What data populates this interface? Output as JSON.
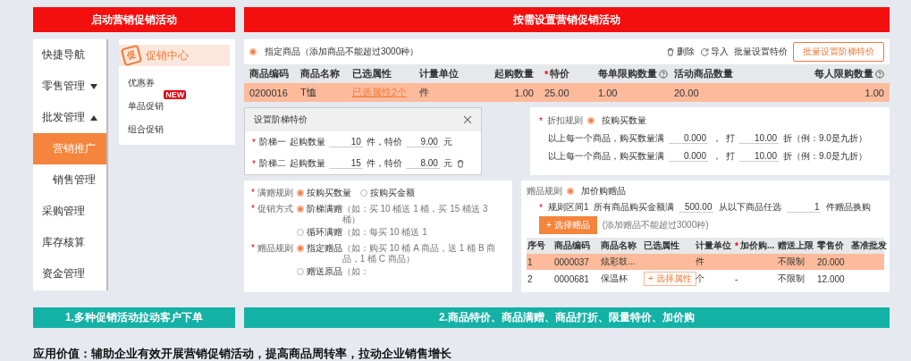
{
  "left": {
    "banner": "启动营销促销活动",
    "sidebar": {
      "items": [
        {
          "label": "快捷导航",
          "selected": false
        },
        {
          "label": "零售管理",
          "selected": false,
          "expanded": false
        },
        {
          "label": "批发管理",
          "selected": false,
          "expanded": true,
          "children": [
            {
              "label": "营销推广",
              "selected": true
            },
            {
              "label": "销售管理",
              "selected": false
            }
          ]
        },
        {
          "label": "采购管理",
          "selected": false
        },
        {
          "label": "库存核算",
          "selected": false
        },
        {
          "label": "资金管理",
          "selected": false
        }
      ]
    },
    "submenu": {
      "logo": "促",
      "title": "促销中心",
      "items": [
        {
          "label": "优惠券"
        },
        {
          "label": "单品促销",
          "badge": "NEW"
        },
        {
          "label": "组合促销"
        }
      ]
    },
    "caption": "1.多种促销活动拉动客户下单"
  },
  "right": {
    "banner": "按需设置营销促销活动",
    "product_table": {
      "scope": {
        "label": "指定商品（添加商品不能超过3000种）",
        "selected": true
      },
      "actions": [
        {
          "kind": "delete",
          "label": "删除"
        },
        {
          "kind": "import",
          "label": "导入"
        },
        {
          "kind": "link",
          "label": "批量设置特价"
        },
        {
          "kind": "button",
          "label": "批量设置阶梯特价"
        }
      ],
      "columns": [
        {
          "label": "商品编码"
        },
        {
          "label": "商品名称"
        },
        {
          "label": "已选属性",
          "kind": "link"
        },
        {
          "label": "计量单位"
        },
        {
          "label": "起购数量",
          "numeric": true
        },
        {
          "label": "特价",
          "mark": "*"
        },
        {
          "label": "每单限购数量",
          "help": true
        },
        {
          "label": "活动商品数量"
        },
        {
          "label": "每人限购数量",
          "help": true,
          "numeric": true
        }
      ],
      "rows": [
        {
          "selected": true,
          "cells": [
            "0200016",
            "T恤",
            "已选属性2个",
            "件",
            "1.00",
            "25.00",
            "1.00",
            "20.00",
            "1.00"
          ]
        }
      ]
    },
    "tier_dialog": {
      "title": "设置阶梯特价",
      "tiers": [
        {
          "mark": "*",
          "label": "阶梯一",
          "qty_label": "起购数量",
          "qty": "10",
          "unit": "件，特价",
          "price": "9.00",
          "currency": "元",
          "deletable": false
        },
        {
          "mark": "*",
          "label": "阶梯二",
          "qty_label": "起购数量",
          "qty": "15",
          "unit": "件，特价",
          "price": "8.00",
          "currency": "元",
          "deletable": true
        }
      ]
    },
    "discount_panel": {
      "mark": "*",
      "label": "折扣规则",
      "options": [
        {
          "label": "按购买数量",
          "selected": true
        }
      ],
      "rows": [
        {
          "prefix": "以上每一个商品，购买数量满",
          "qty": "0.000",
          "sep": "，",
          "verb": "打",
          "rate": "10.00",
          "suffix": "折（例：9.0是九折）"
        },
        {
          "prefix": "以上每一个商品，购买数量满",
          "qty": "0.000",
          "sep": "，",
          "verb": "打",
          "rate": "10.00",
          "suffix": "折（例：9.0是九折）"
        }
      ]
    },
    "gift_panel": {
      "rules": [
        {
          "mark": "*",
          "label": "满赠规则",
          "options": [
            {
              "name": "按购买数量",
              "selected": true
            },
            {
              "name": "按购买金额",
              "selected": false
            }
          ]
        },
        {
          "mark": "*",
          "label": "促销方式",
          "options": [
            {
              "name": "阶梯满赠",
              "hint": "（如：买 10 桶送 1 桶，买 15 桶送 3 桶）",
              "selected": true
            },
            {
              "name": "循环满赠",
              "hint": "（如：每买 10 桶送 1",
              "selected": false
            }
          ]
        },
        {
          "mark": "*",
          "label": "赠品规则",
          "options": [
            {
              "name": "指定赠品",
              "hint": "（如：购买 10 桶 A 商品，送 1 桶 B 商品，1 桶 C 商品）",
              "selected": true
            },
            {
              "name": "赠送原品",
              "hint": "（如：",
              "selected": false
            }
          ]
        }
      ]
    },
    "addon_panel": {
      "label": "赠品规则",
      "option": {
        "label": "加价购赠品",
        "selected": true
      },
      "interval": {
        "mark": "*",
        "label": "规则区间1",
        "amount_label": "所有商品购买金额满",
        "amount": "500.00",
        "pick_label": "从以下商品任选",
        "pick": "1",
        "pick_suffix": "件赠品换购",
        "button": "+ 选择赠品",
        "note": "(添加赠品不能超过3000种)"
      },
      "columns": [
        {
          "label": "序号"
        },
        {
          "label": "商品编码"
        },
        {
          "label": "商品名称"
        },
        {
          "label": "已选属性"
        },
        {
          "label": "计量单位"
        },
        {
          "label": "加价购...",
          "mark": "*"
        },
        {
          "label": "赠送上限"
        },
        {
          "label": "零售价"
        },
        {
          "label": "基准批发"
        }
      ],
      "rows": [
        {
          "selected": true,
          "cells": [
            "1",
            "0000037",
            "炫彩鼓...",
            null,
            "件",
            null,
            "不限制",
            "20.000",
            null
          ]
        },
        {
          "selected": false,
          "cells": [
            "2",
            "0000681",
            "保温杯",
            {
              "kind": "button",
              "text": "+ 选择属性"
            },
            "个",
            "-",
            "不限制",
            "12.000",
            null
          ]
        }
      ]
    },
    "caption": "2.商品特价、商品满赠、商品打折、限量特价、加价购"
  },
  "value_statement": "应用价值：辅助企业有效开展营销促销活动，提高商品周转率，拉动企业销售增长"
}
